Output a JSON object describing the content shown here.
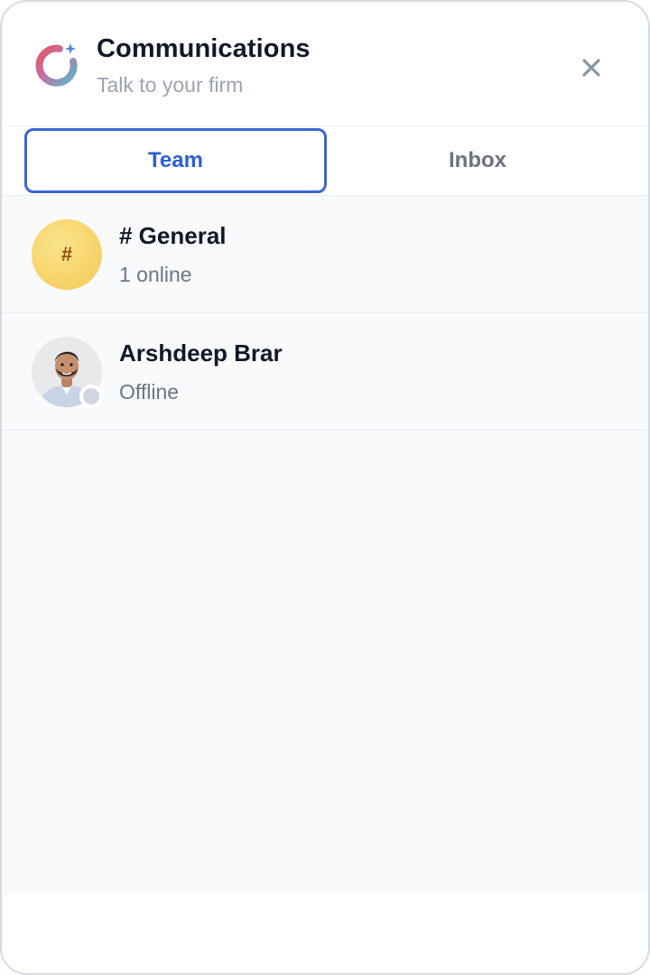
{
  "header": {
    "title": "Communications",
    "subtitle": "Talk to your firm",
    "logo_icon": "ring-logo-icon",
    "close_icon": "close-icon"
  },
  "tabs": [
    {
      "label": "Team",
      "active": true
    },
    {
      "label": "Inbox",
      "active": false
    }
  ],
  "channels": [
    {
      "name": "# General",
      "status": "1 online",
      "avatar_text": "#",
      "avatar_color": "#f6d46a"
    },
    {
      "name": "Arshdeep Brar",
      "status": "Offline",
      "presence": "offline",
      "presence_color": "#cfd6e2"
    }
  ],
  "colors": {
    "accent": "#3a66d4",
    "title": "#111827",
    "muted": "#9aa3b0"
  }
}
